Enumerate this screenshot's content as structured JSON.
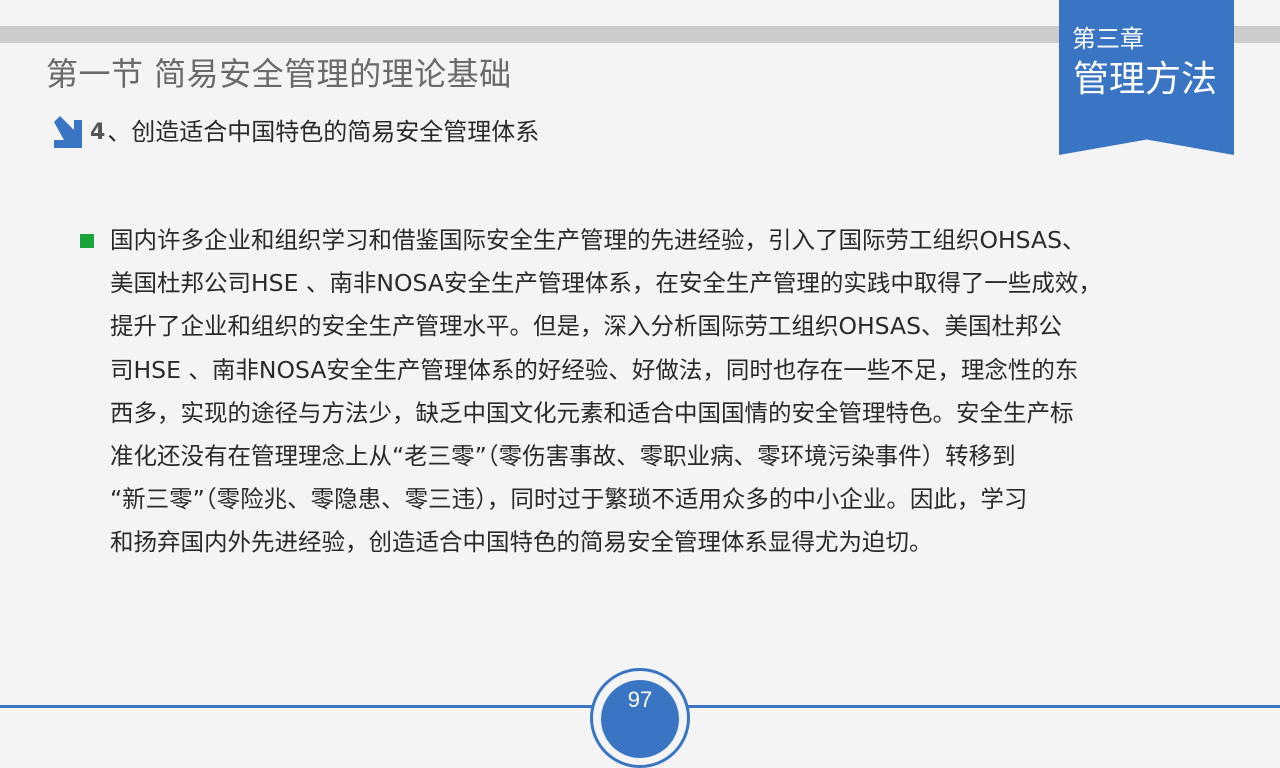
{
  "header": {
    "section_title": "第一节  简易安全管理的理论基础",
    "chapter_number": "第三章",
    "chapter_name": "管理方法"
  },
  "subheading": {
    "number": "4",
    "text": "、创造适合中国特色的简易安全管理体系"
  },
  "content": {
    "lines": [
      "国内许多企业和组织学习和借鉴国际安全生产管理的先进经验，引入了国际劳工组织OHSAS、",
      "美国杜邦公司HSE 、南非NOSA安全生产管理体系，在安全生产管理的实践中取得了一些成效，",
      "提升了企业和组织的安全生产管理水平。但是，深入分析国际劳工组织OHSAS、美国杜邦公",
      "司HSE 、南非NOSA安全生产管理体系的好经验、好做法，同时也存在一些不足，理念性的东",
      "西多，实现的途径与方法少，缺乏中国文化元素和适合中国国情的安全管理特色。安全生产标",
      "准化还没有在管理理念上从“老三零”（零伤害事故、零职业病、零环境污染事件）转移到",
      "“新三零”（零险兆、零隐患、零三违），同时过于繁琐不适用众多的中小企业。因此，学习",
      "和扬弃国内外先进经验，创造适合中国特色的简易安全管理体系显得尤为迫切。"
    ]
  },
  "footer": {
    "page_number": "97"
  },
  "colors": {
    "accent_blue": "#3a75c4",
    "bullet_green": "#1aa43a",
    "band_gray": "#cccccc"
  },
  "icons": {
    "subheading_icon": "arrow-down-right-icon",
    "bullet_icon": "square-bullet-icon"
  }
}
